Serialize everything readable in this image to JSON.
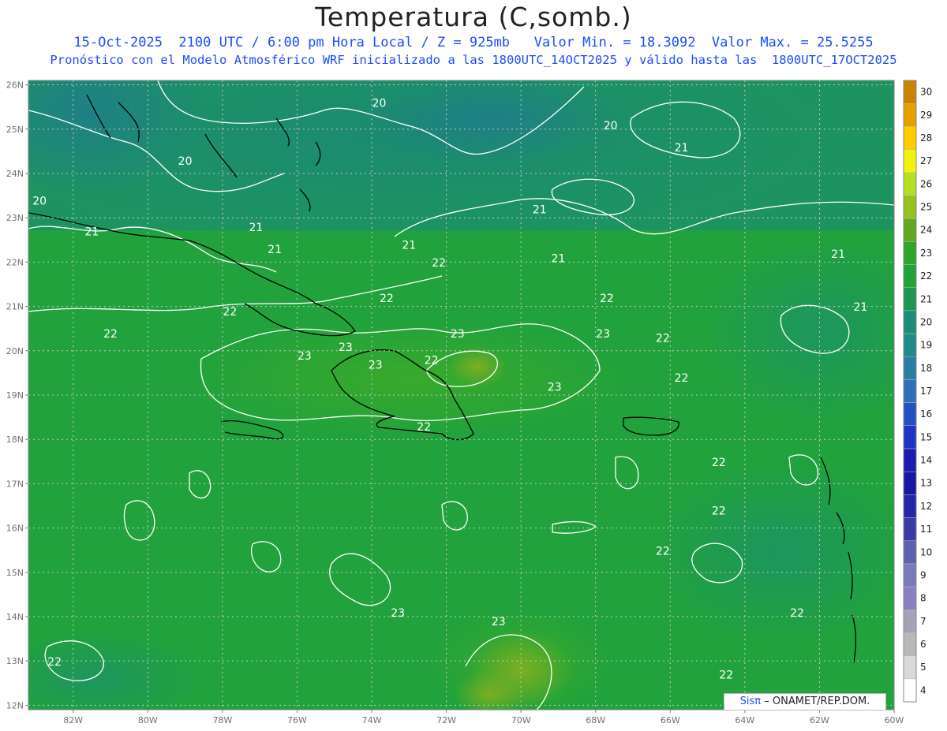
{
  "header": {
    "title": "Temperatura (C,somb.)",
    "line1": "15-Oct-2025  2100 UTC / 6:00 pm Hora Local / Z = 925mb   Valor Min. = 18.3092  Valor Max. = 25.5255",
    "line2": "Pronóstico con el Modelo Atmosférico WRF inicializado a las 1800UTC_14OCT2025 y válido hasta las  1800UTC_17OCT2025"
  },
  "map": {
    "lon_range": [
      -83.2,
      -60
    ],
    "lat_range": [
      11.9,
      26.1
    ],
    "lat_ticks": [
      "26N",
      "25N",
      "24N",
      "23N",
      "22N",
      "21N",
      "20N",
      "19N",
      "18N",
      "17N",
      "16N",
      "15N",
      "14N",
      "13N",
      "12N"
    ],
    "lon_ticks": [
      "82W",
      "80W",
      "78W",
      "76W",
      "74W",
      "72W",
      "70W",
      "68W",
      "66W",
      "64W",
      "62W",
      "60W"
    ],
    "grid": "dotted",
    "contour_color": "#ffffff",
    "coast_color": "#000000",
    "contour_labels": [
      {
        "text": "20",
        "lon": -73.8,
        "lat": 25.5
      },
      {
        "text": "20",
        "lon": -67.6,
        "lat": 25.0
      },
      {
        "text": "20",
        "lon": -79.0,
        "lat": 24.2
      },
      {
        "text": "20",
        "lon": -82.9,
        "lat": 23.3
      },
      {
        "text": "21",
        "lon": -81.5,
        "lat": 22.6
      },
      {
        "text": "21",
        "lon": -77.1,
        "lat": 22.7
      },
      {
        "text": "21",
        "lon": -76.6,
        "lat": 22.2
      },
      {
        "text": "21",
        "lon": -73.0,
        "lat": 22.3
      },
      {
        "text": "21",
        "lon": -69.5,
        "lat": 23.1
      },
      {
        "text": "21",
        "lon": -69.0,
        "lat": 22.0
      },
      {
        "text": "21",
        "lon": -65.7,
        "lat": 24.5
      },
      {
        "text": "21",
        "lon": -61.5,
        "lat": 22.1
      },
      {
        "text": "21",
        "lon": -60.9,
        "lat": 20.9
      },
      {
        "text": "22",
        "lon": -72.2,
        "lat": 21.9
      },
      {
        "text": "22",
        "lon": -73.6,
        "lat": 21.1
      },
      {
        "text": "22",
        "lon": -77.8,
        "lat": 20.8
      },
      {
        "text": "22",
        "lon": -81.0,
        "lat": 20.3
      },
      {
        "text": "22",
        "lon": -67.7,
        "lat": 21.1
      },
      {
        "text": "22",
        "lon": -66.2,
        "lat": 20.2
      },
      {
        "text": "22",
        "lon": -65.7,
        "lat": 19.3
      },
      {
        "text": "22",
        "lon": -72.4,
        "lat": 19.7
      },
      {
        "text": "22",
        "lon": -72.6,
        "lat": 18.2
      },
      {
        "text": "22",
        "lon": -64.7,
        "lat": 17.4
      },
      {
        "text": "22",
        "lon": -64.7,
        "lat": 16.3
      },
      {
        "text": "22",
        "lon": -66.2,
        "lat": 15.4
      },
      {
        "text": "22",
        "lon": -62.6,
        "lat": 14.0
      },
      {
        "text": "22",
        "lon": -64.5,
        "lat": 12.6
      },
      {
        "text": "22",
        "lon": -82.5,
        "lat": 12.9
      },
      {
        "text": "23",
        "lon": -71.7,
        "lat": 20.3
      },
      {
        "text": "23",
        "lon": -74.7,
        "lat": 20.0
      },
      {
        "text": "23",
        "lon": -75.8,
        "lat": 19.8
      },
      {
        "text": "23",
        "lon": -73.9,
        "lat": 19.6
      },
      {
        "text": "23",
        "lon": -67.8,
        "lat": 20.3
      },
      {
        "text": "23",
        "lon": -69.1,
        "lat": 19.1
      },
      {
        "text": "23",
        "lon": -73.3,
        "lat": 14.0
      },
      {
        "text": "23",
        "lon": -70.6,
        "lat": 13.8
      }
    ]
  },
  "colorbar": {
    "levels": [
      "4",
      "5",
      "6",
      "7",
      "8",
      "9",
      "10",
      "11",
      "12",
      "13",
      "14",
      "15",
      "16",
      "17",
      "18",
      "19",
      "20",
      "21",
      "22",
      "23",
      "24",
      "25",
      "26",
      "27",
      "28",
      "29",
      "30"
    ],
    "colors": [
      "#ffffff",
      "#d9d9d9",
      "#b8b8b8",
      "#a3a3b8",
      "#8a7fbf",
      "#7a7ab8",
      "#5c62b0",
      "#3a3aa6",
      "#2424a6",
      "#1717a3",
      "#1a1ab0",
      "#1f33c2",
      "#2451c2",
      "#2e70b8",
      "#2a7ea3",
      "#1f8a8a",
      "#1b8c75",
      "#1f9652",
      "#21a33a",
      "#2ea62e",
      "#64a820",
      "#96c21f",
      "#b5e01f",
      "#f2f20d",
      "#ffcc00",
      "#e6a000",
      "#c98500"
    ]
  },
  "credit": {
    "brand": "Sisπ",
    "text": "– ONAMET/REP.DOM."
  }
}
